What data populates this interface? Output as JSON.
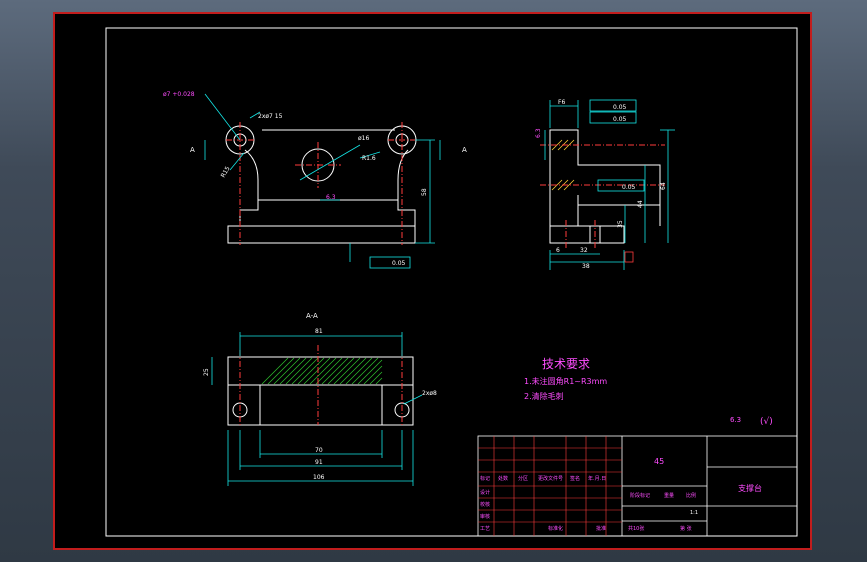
{
  "sheet": {
    "section_label": "A",
    "section_title": "A-A",
    "surface_roughness_value": "6.3",
    "general_roughness": "(√)"
  },
  "dims": {
    "front": {
      "hole_tl": "2xø7 15",
      "hole_tl2": "ø7 +0.028",
      "phi16": "ø16",
      "r15": "R15",
      "r16": "R1.6",
      "h58": "58",
      "ra": "6.3",
      "flat": "0.05",
      "phi_top": "2xø7"
    },
    "side": {
      "f6": "F6",
      "tol1": "0.05",
      "tol2": "0.05",
      "tol3": "0.05",
      "h64": "64",
      "h44": "44",
      "h35": "35",
      "w6": "6",
      "w32": "32",
      "w38": "38",
      "ra": "6.3",
      "flat": "0.05"
    },
    "section": {
      "w81": "81",
      "w70": "70",
      "w91": "91",
      "w106": "106",
      "h25": "25",
      "hole": "2xø8"
    }
  },
  "notes": {
    "title": "技术要求",
    "line1": "1.未注圆角R1~R3mm",
    "line2": "2.清除毛刺"
  },
  "title_block": {
    "material": "45",
    "part_name": "支撑台",
    "row_labels": [
      "标记",
      "设计",
      "校核",
      "审核",
      "工艺"
    ],
    "header_cells": [
      "处数",
      "分区",
      "更改文件号",
      "签名",
      "年.月.日"
    ],
    "stage_label": "阶段标记",
    "weight_label": "重量",
    "scale_label": "比例",
    "scale_value": "1:1",
    "sheets": "共10张",
    "sheet_no": "第 张",
    "std": "标准化",
    "approve": "批准"
  }
}
